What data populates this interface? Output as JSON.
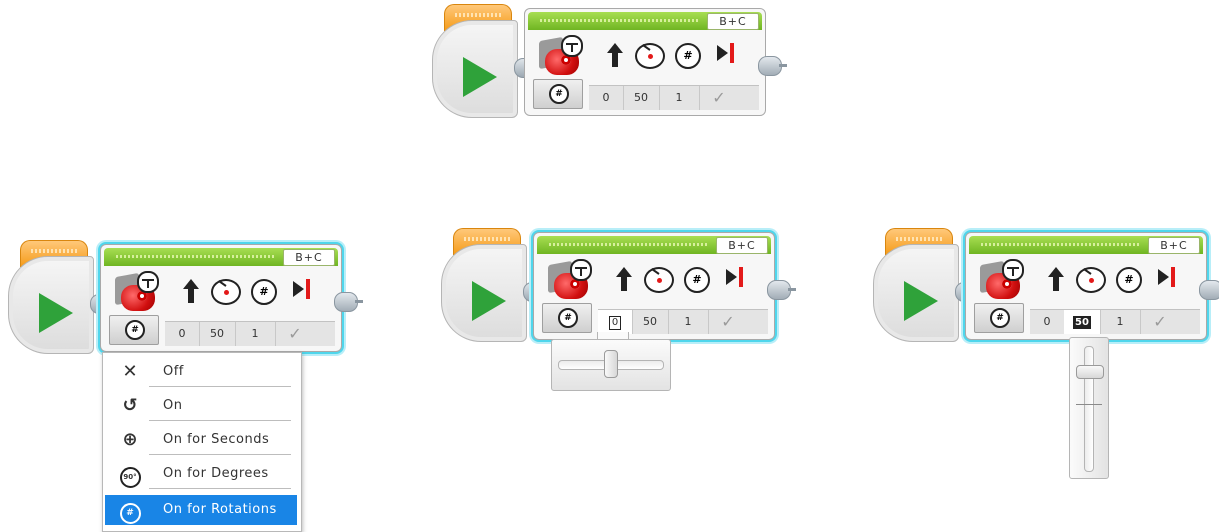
{
  "blocks": [
    {
      "id": "top",
      "port": "B+C",
      "mode_icon": "#",
      "values": {
        "steering": "0",
        "power": "50",
        "rotations": "1",
        "brake": "✓"
      }
    },
    {
      "id": "menu",
      "port": "B+C",
      "mode_icon": "#",
      "values": {
        "steering": "0",
        "power": "50",
        "rotations": "1",
        "brake": "✓"
      }
    },
    {
      "id": "steer",
      "port": "B+C",
      "mode_icon": "#",
      "values": {
        "steering": "0",
        "power": "50",
        "rotations": "1",
        "brake": "✓"
      }
    },
    {
      "id": "power",
      "port": "B+C",
      "mode_icon": "#",
      "values": {
        "steering": "0",
        "power": "50",
        "rotations": "1",
        "brake": "✓"
      }
    }
  ],
  "mode_menu": {
    "items": [
      {
        "label": "Off",
        "icon": "x-icon",
        "glyph": "✕"
      },
      {
        "label": "On",
        "icon": "rotate-icon",
        "glyph": "↺"
      },
      {
        "label": "On for Seconds",
        "icon": "timer-icon",
        "glyph": "⊕"
      },
      {
        "label": "On for Degrees",
        "icon": "degrees-icon",
        "glyph": "90°"
      },
      {
        "label": "On for Rotations",
        "icon": "rotations-icon",
        "glyph": "#"
      }
    ],
    "selected": "On for Rotations"
  },
  "sliders": {
    "steering": {
      "value": 0,
      "min": -100,
      "max": 100
    },
    "power": {
      "value": 50,
      "min": -100,
      "max": 100
    }
  },
  "colors": {
    "start_green": "#2fa23a",
    "header_green": "#6fb522",
    "selection_cyan": "#4fd6ec",
    "menu_highlight": "#1985e6",
    "motor_red": "#d10f0f"
  }
}
